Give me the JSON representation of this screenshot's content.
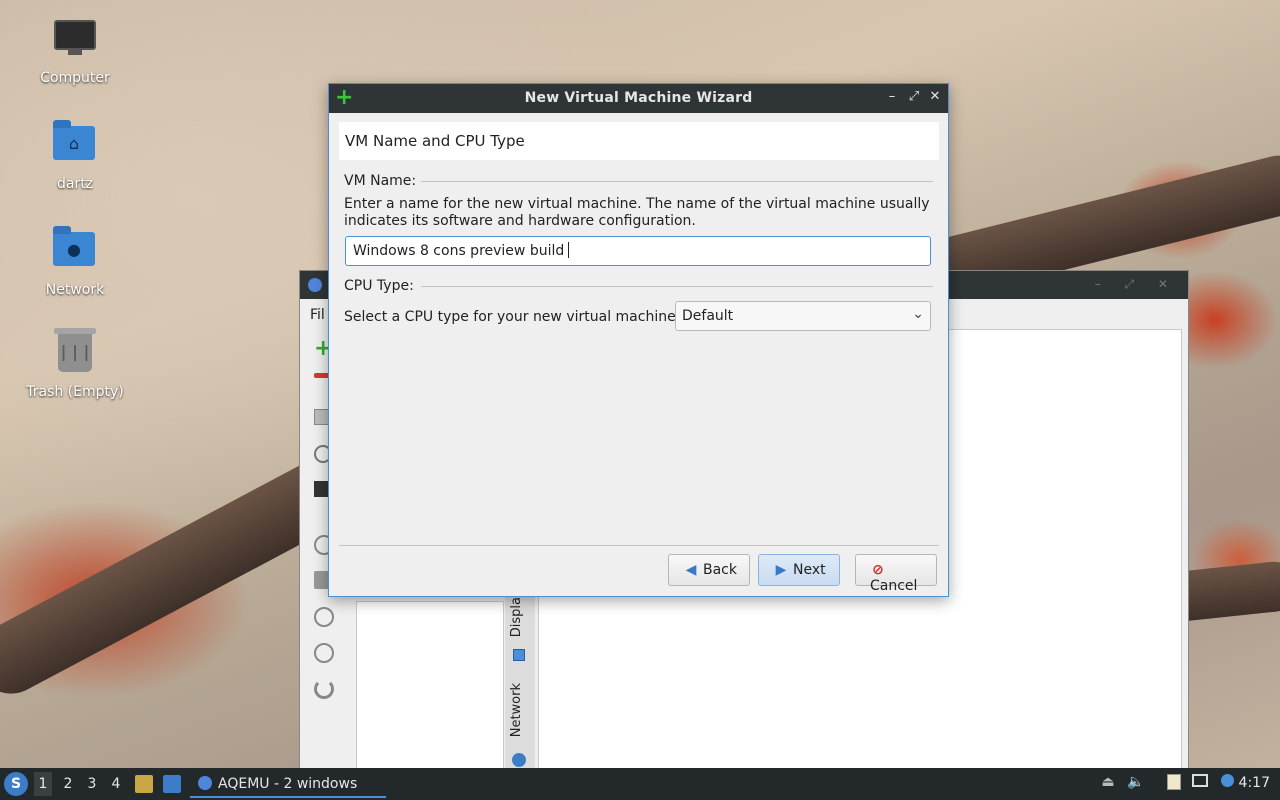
{
  "desktop": {
    "icons": [
      {
        "label": "Computer"
      },
      {
        "label": "dartz"
      },
      {
        "label": "Network"
      },
      {
        "label": "Trash (Empty)"
      }
    ]
  },
  "background_window": {
    "menu_first": "Fil",
    "tab_display": "Displa",
    "tab_network": "Network"
  },
  "dialog": {
    "title": "New Virtual Machine Wizard",
    "header": "VM Name and CPU Type",
    "vm_name_label": "VM Name:",
    "vm_name_description": "Enter a name for the new virtual machine. The name of the virtual machine usually indicates its software and hardware configuration.",
    "vm_name_value": "Windows 8 cons preview build",
    "cpu_type_label": "CPU Type:",
    "cpu_prompt": "Select a CPU type for your new virtual machine:",
    "cpu_selected": "Default",
    "buttons": {
      "back": "Back",
      "next": "Next",
      "cancel": "Cancel"
    }
  },
  "taskbar": {
    "workspaces": [
      "1",
      "2",
      "3",
      "4"
    ],
    "task_label": "AQEMU - 2 windows",
    "clock": "4:17"
  }
}
